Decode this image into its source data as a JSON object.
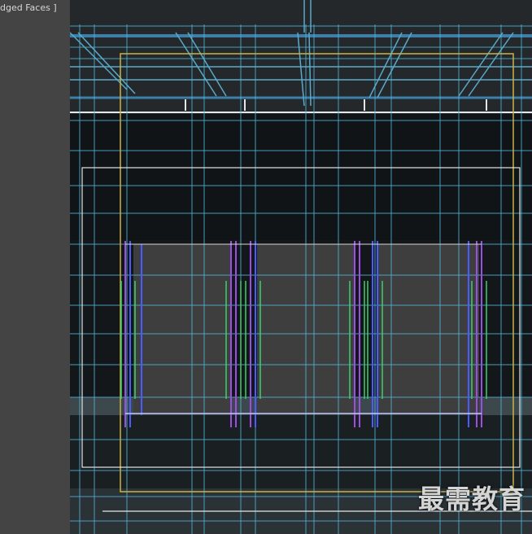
{
  "viewport": {
    "label": "dged Faces ]",
    "watermark": "最需教育"
  },
  "colors": {
    "grid": "#4fb3d6",
    "frame_white": "#e6e6e6",
    "frame_yellow": "#c9b24a",
    "glass": "#3f3f3f",
    "door_purple": "#9b4fe0",
    "door_blue": "#4a5cff",
    "handle_green": "#3fd06a",
    "ceiling": "#25292c"
  }
}
